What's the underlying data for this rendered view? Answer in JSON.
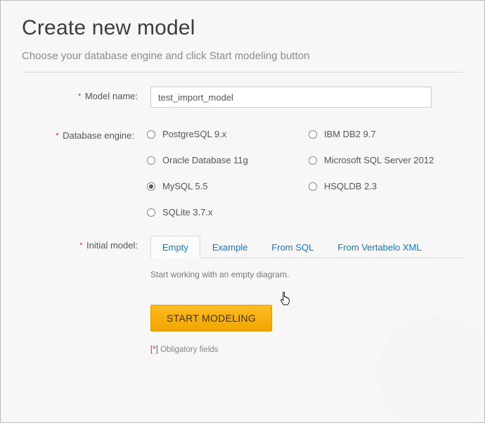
{
  "header": {
    "title": "Create new model",
    "subtitle": "Choose your database engine and click Start modeling button"
  },
  "form": {
    "model_name": {
      "label": "Model name:",
      "value": "test_import_model"
    },
    "db_engine": {
      "label": "Database engine:",
      "options": [
        {
          "label": "PostgreSQL 9.x",
          "checked": false
        },
        {
          "label": "IBM DB2 9.7",
          "checked": false
        },
        {
          "label": "Oracle Database 11g",
          "checked": false
        },
        {
          "label": "Microsoft SQL Server 2012",
          "checked": false
        },
        {
          "label": "MySQL 5.5",
          "checked": true
        },
        {
          "label": "HSQLDB 2.3",
          "checked": false
        },
        {
          "label": "SQLite 3.7.x",
          "checked": false
        }
      ]
    },
    "initial_model": {
      "label": "Initial model:",
      "tabs": [
        {
          "label": "Empty",
          "active": true
        },
        {
          "label": "Example",
          "active": false
        },
        {
          "label": "From SQL",
          "active": false
        },
        {
          "label": "From Vertabelo XML",
          "active": false
        }
      ],
      "description": "Start working with an empty diagram."
    },
    "submit_label": "START MODELING",
    "obligatory_note": {
      "marker": "[*]",
      "text": "Obligatory fields"
    }
  }
}
